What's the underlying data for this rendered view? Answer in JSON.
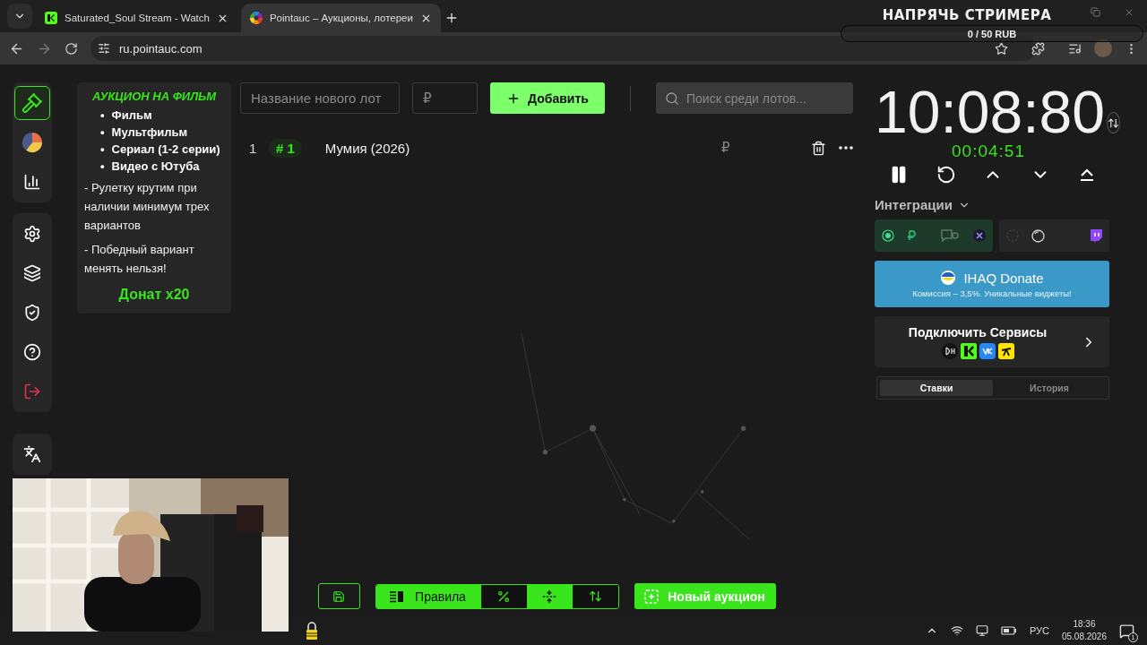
{
  "browser": {
    "tabs": [
      {
        "title": "Saturated_Soul Stream - Watch",
        "kind": "stream",
        "selected": false
      },
      {
        "title": "Pointauc – Аукционы, лотереи",
        "kind": "wheel",
        "selected": true
      }
    ],
    "url": "ru.pointauc.com"
  },
  "overlay_widget": {
    "title": "НАПРЯЧЬ СТРИМЕРА",
    "progress": "0 / 50 RUB",
    "level": 0
  },
  "sidebar": {
    "groups": [
      [
        {
          "kind": "gavel",
          "selected": true
        },
        {
          "kind": "pie",
          "selected": false
        },
        {
          "kind": "bars",
          "selected": false
        }
      ],
      [
        {
          "kind": "settings",
          "selected": false
        },
        {
          "kind": "layers",
          "selected": false
        },
        {
          "kind": "shield",
          "selected": false
        },
        {
          "kind": "help",
          "selected": false
        },
        {
          "kind": "logout",
          "selected": false
        }
      ],
      [
        {
          "kind": "language",
          "selected": false
        }
      ]
    ]
  },
  "rules_card": {
    "title": "АУКЦИОН НА ФИЛЬМ",
    "items": [
      {
        "bullet": "•",
        "text": "Фильм"
      },
      {
        "bullet": "•",
        "text": "Мультфильм"
      },
      {
        "bullet": "•",
        "text": "Сериал (1-2 серии)"
      },
      {
        "bullet": "•",
        "text": "Видео с Ютуба"
      }
    ],
    "notes": [
      "- Рулетку крутим при наличии минимум трех вариантов",
      "- Победный вариант менять нельзя!"
    ],
    "footer": "Донат x20"
  },
  "lot_form": {
    "name_placeholder": "Название нового лот",
    "amount_placeholder": "₽",
    "add_button": "Добавить",
    "search_placeholder": "Поиск среди лотов..."
  },
  "lots": [
    {
      "index": "1",
      "rank": "# 1",
      "name": "Мумия (2026)",
      "amount": "₽"
    }
  ],
  "timer": {
    "main": "10:08:80",
    "elapsed": "00:04:51"
  },
  "integrations": {
    "label": "Интеграции",
    "cards": [
      {
        "kind": "donations",
        "active": true
      },
      {
        "kind": "twitch",
        "active": false
      }
    ]
  },
  "promo": {
    "title": "IHAQ Donate",
    "subtitle": "Комиссия – 3,5%. Уникальные виджеты!"
  },
  "connect": {
    "title": "Подключить Сервисы"
  },
  "history_tabs": [
    {
      "label": "Ставки",
      "selected": true
    },
    {
      "label": "История",
      "selected": false
    }
  ],
  "bottom_bar": {
    "rules_button": "Правила",
    "new_auction_button": "Новый аукцион"
  },
  "taskbar": {
    "language": "РУС",
    "time": "18:36",
    "date": "05.08.2026",
    "notifications": "1"
  }
}
